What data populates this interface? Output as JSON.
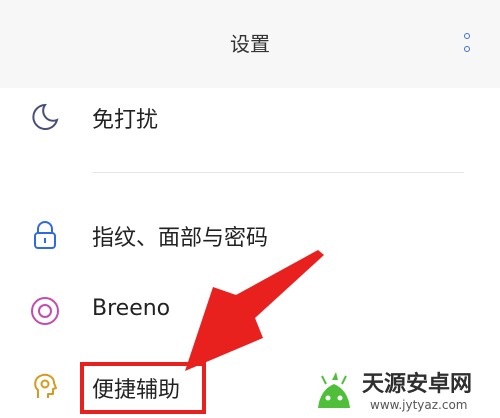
{
  "header": {
    "title": "设置",
    "more_icon": "more-vertical-icon"
  },
  "items": [
    {
      "label": "免打扰",
      "icon": "moon-icon"
    },
    {
      "label": "指纹、面部与密码",
      "icon": "lock-icon"
    },
    {
      "label": "Breeno",
      "icon": "breeno-icon"
    },
    {
      "label": "便捷辅助",
      "icon": "assist-icon"
    }
  ],
  "annotation": {
    "color": "#e8211f"
  },
  "watermark": {
    "name": "天源安卓网",
    "url": "www.jytyaz.com"
  }
}
